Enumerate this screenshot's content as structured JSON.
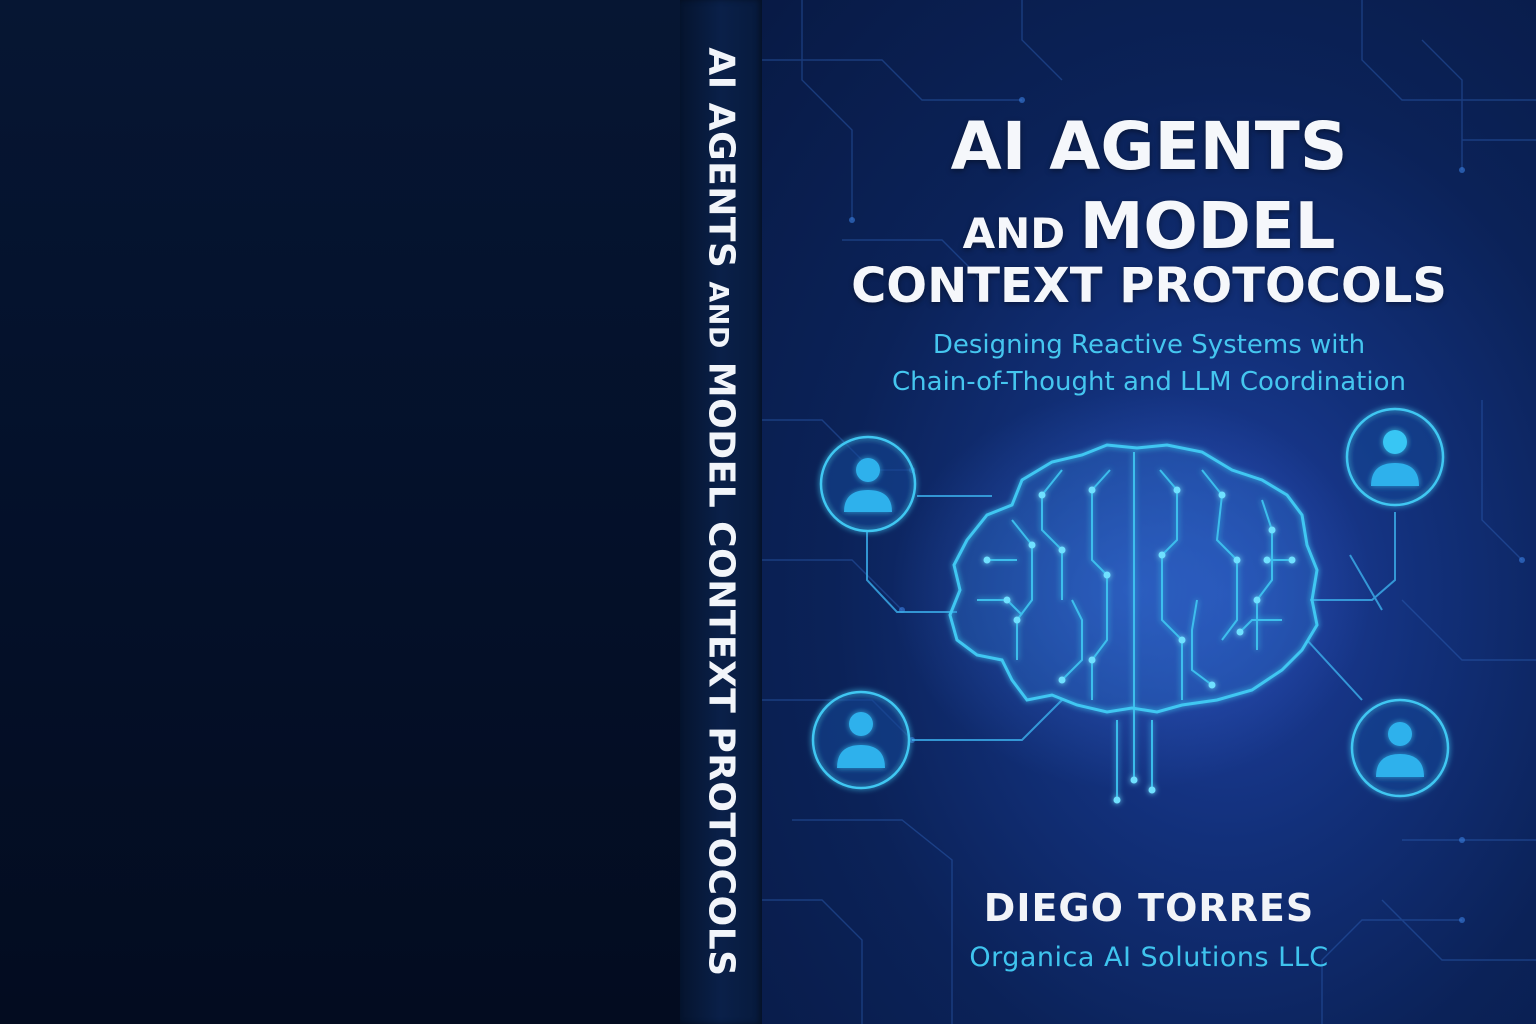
{
  "spine": {
    "title_part1": "AI AGENTS ",
    "title_and": "AND",
    "title_part2": " MODEL CONTEXT PROTOCOLS"
  },
  "front": {
    "title_line1": "AI AGENTS",
    "title_line2_small": "AND ",
    "title_line2_big": "MODEL",
    "title_line3": "CONTEXT PROTOCOLS",
    "subtitle_line1": "Designing Reactive Systems with",
    "subtitle_line2": "Chain-of-Thought and LLM Coordination",
    "author": "DIEGO TORRES",
    "publisher": "Organica AI Solutions LLC"
  },
  "colors": {
    "accent_cyan": "#45c6ef",
    "background_navy": "#04132b",
    "cover_blue": "#12307a",
    "title_white": "#f5f7fb"
  },
  "icons": [
    "agent-avatar-icon",
    "brain-circuit-icon"
  ]
}
